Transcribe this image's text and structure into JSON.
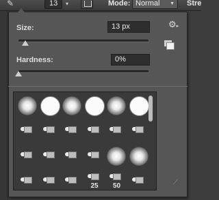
{
  "toolbar": {
    "tool_icon": "brush-tool-icon",
    "brush_size_value": "13",
    "brush_picker_caret": "▾",
    "mode_label": "Mode:",
    "mode_value": "Normal",
    "strength_label": "Stre"
  },
  "popup": {
    "size_label": "Size:",
    "size_value": "13 px",
    "hardness_label": "Hardness:",
    "hardness_value": "0%",
    "size_slider_fraction": 0.05,
    "hardness_slider_fraction": 0.0
  },
  "presets": [
    {
      "type": "soft"
    },
    {
      "type": "hard"
    },
    {
      "type": "soft"
    },
    {
      "type": "hard"
    },
    {
      "type": "soft"
    },
    {
      "type": "hard"
    },
    {
      "type": "tool"
    },
    {
      "type": "tool"
    },
    {
      "type": "tool"
    },
    {
      "type": "tool"
    },
    {
      "type": "tool"
    },
    {
      "type": "tool"
    },
    {
      "type": "tool"
    },
    {
      "type": "tool"
    },
    {
      "type": "tool"
    },
    {
      "type": "tool"
    },
    {
      "type": "soft"
    },
    {
      "type": "soft"
    },
    {
      "type": "tool"
    },
    {
      "type": "tool"
    },
    {
      "type": "tool"
    },
    {
      "type": "tool",
      "label": "25"
    },
    {
      "type": "tool",
      "label": "50"
    },
    {
      "type": "tool"
    }
  ],
  "colors": {
    "panel_bg": "#565656",
    "app_bg": "#3d3d3d",
    "field_bg": "#2e2e2e",
    "grid_bg": "#3a3a3a"
  }
}
